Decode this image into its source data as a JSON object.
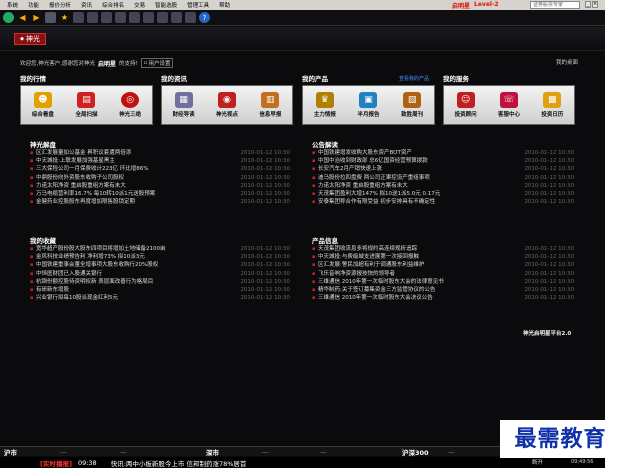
{
  "menubar": {
    "items": [
      "系统",
      "功能",
      "报价分析",
      "资讯",
      "综合排名",
      "交易",
      "智能选股",
      "管理工具",
      "帮助"
    ],
    "app_name": "启明星",
    "level": "Level-2",
    "search_placeholder": "证券股票专家"
  },
  "header": {
    "brand": "神光"
  },
  "welcome": {
    "greeting": "欢迎您,神光客户,感谢您对神光",
    "username": "启明星",
    "suffix": "的支持!",
    "settings_label": "用户设置",
    "desktop_link": "我的桌面"
  },
  "sections": [
    {
      "title": "我的行情",
      "more": "",
      "items": [
        {
          "label": "综合看盘",
          "icon": "person-chart-icon",
          "color": "#e0a000"
        },
        {
          "label": "全局扫描",
          "icon": "scan-icon",
          "color": "#d02020"
        },
        {
          "label": "神光三绝",
          "icon": "target-icon",
          "color": "#c01010"
        }
      ]
    },
    {
      "title": "我的资讯",
      "more": "",
      "items": [
        {
          "label": "财经导读",
          "icon": "news-icon",
          "color": "#7070a0"
        },
        {
          "label": "神光视点",
          "icon": "eye-icon",
          "color": "#c02020"
        },
        {
          "label": "信息早报",
          "icon": "paper-icon",
          "color": "#c07020"
        }
      ]
    },
    {
      "title": "我的产品",
      "more": "查看我的产品",
      "items": [
        {
          "label": "主力情报",
          "icon": "trophy-icon",
          "color": "#b08000"
        },
        {
          "label": "半月报告",
          "icon": "report-icon",
          "color": "#2080c0"
        },
        {
          "label": "致胜周刊",
          "icon": "book-icon",
          "color": "#b06010"
        }
      ]
    },
    {
      "title": "我的服务",
      "more": "",
      "items": [
        {
          "label": "投资顾问",
          "icon": "advisor-icon",
          "color": "#c02020"
        },
        {
          "label": "客服中心",
          "icon": "service-icon",
          "color": "#c01040"
        },
        {
          "label": "投资日历",
          "icon": "calendar-icon",
          "color": "#e0a010"
        }
      ]
    }
  ],
  "panels": {
    "jiepan": {
      "title": "神光解盘",
      "rows": [
        {
          "t": "区汇发展量加公基金 昇积议套遭两倍添",
          "d": "2010-01-12 10:30"
        },
        {
          "t": "中天城投:上联发展加强基星黑主",
          "d": "2010-01-12 10:30"
        },
        {
          "t": "三大保险公司一月保费收计223亿 环比增86%",
          "d": "2010-01-12 10:30"
        },
        {
          "t": "中鼎股份向外资股东收购子公司股权",
          "d": "2010-01-12 10:30"
        },
        {
          "t": "力诺太阳净资 重启股重组方案有未大",
          "d": "2010-01-12 10:30"
        },
        {
          "t": "万马电缆营利率16.7% 每10转10派1元送股预案",
          "d": "2010-01-12 10:30"
        },
        {
          "t": "金健药业控股股东再度增加限售股锁定期",
          "d": "2010-01-12 10:30"
        }
      ]
    },
    "gonggao": {
      "title": "公告解读",
      "rows": [
        {
          "t": "中国铁建增发收购大股东资产BOT资产",
          "d": "2010-01-12 10:30"
        },
        {
          "t": "中国中治收到财政部 总6亿国资经营预算拨款",
          "d": "2010-01-12 10:30"
        },
        {
          "t": "长安汽车2月产销快速上涨",
          "d": "2010-01-12 10:30"
        },
        {
          "t": "迪马股份拉四盘费 两公司正果控设产重组事项",
          "d": "2010-01-12 10:30"
        },
        {
          "t": "力诺太阳净资 重启股重组方案有未大",
          "d": "2010-01-12 10:30"
        },
        {
          "t": "天茂集团盈利大增147% 拟10送1派5.0元 0.17元",
          "d": "2010-01-12 10:30"
        },
        {
          "t": "安泰集团称合作有限受益 初步安排具有不确定性",
          "d": "2010-01-12 10:30"
        }
      ]
    },
    "shoucang": {
      "title": "我的收藏",
      "rows": [
        {
          "t": "宽华超产股份股大股东四项目将增加土地储备2100亩",
          "d": "2010-01-12 10:30"
        },
        {
          "t": "金风科技业绩预告利 净利增73% 拟10派3元",
          "d": "2010-01-12 10:30"
        },
        {
          "t": "中国铁建重事会董全增事项大股东收购行20%股权",
          "d": "2010-01-12 10:30"
        },
        {
          "t": "中恒医财团已入股通关银行",
          "d": "2010-01-12 10:30"
        },
        {
          "t": "杭钢份额控股待资明权新 表层面改善行为格局目",
          "d": "2010-01-12 10:30"
        },
        {
          "t": "有研新东增股",
          "d": "2010-01-12 10:30"
        },
        {
          "t": "兴业银行拟每10股派现金红利5元",
          "d": "2010-01-12 10:30"
        }
      ]
    },
    "chanpin": {
      "title": "产品信息",
      "rows": [
        {
          "t": "天茂集团收流息多将规约高连续规析追踪",
          "d": "2010-01-12 10:30"
        },
        {
          "t": "中天城投:与费级城支进展第一次接回报触",
          "d": "2010-01-12 10:30"
        },
        {
          "t": "区汇发展:警民加超有利于调通股东利益维护",
          "d": "2010-01-12 10:30"
        },
        {
          "t": "飞乐音响净资源报技快的领导者",
          "d": "2010-01-12 10:30"
        },
        {
          "t": "三维通信 2010年第一次临时股东大会的法律意见书",
          "d": "2010-01-12 10:30"
        },
        {
          "t": "精华制药:关于签订募集资金三方监管协议的公告",
          "d": "2010-01-12 10:30"
        },
        {
          "t": "三维通信 2010年第一次临时股东大会决议公告",
          "d": "2010-01-12 10:30"
        }
      ]
    }
  },
  "platform_link": "神光启明星平台2.0",
  "index_bar": {
    "sh": "沪市",
    "sz": "深市",
    "hs300": "沪深300"
  },
  "ticker": {
    "label": "[实时播报]",
    "time": "09:38",
    "text": "快讯:两中小板新股今上市 信邦制药涨78%居首",
    "status": "断开",
    "clock": "09:49:56"
  },
  "watermark": "最需教育"
}
